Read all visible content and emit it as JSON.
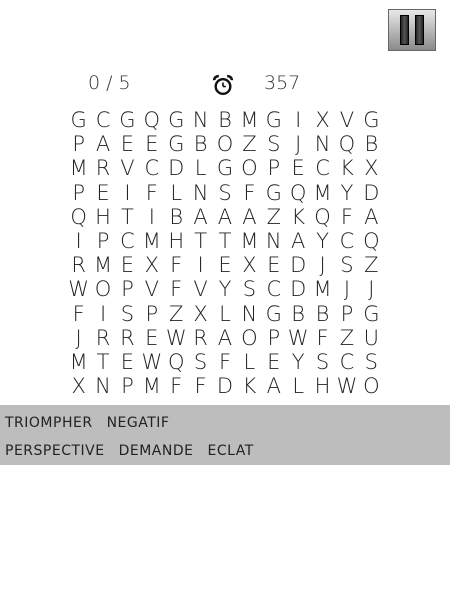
{
  "pause_button": {
    "icon": "pause-icon"
  },
  "stats": {
    "found": "0",
    "separator": "/",
    "total": "5",
    "timer_icon": "alarm-clock-icon",
    "timer": "357"
  },
  "grid": [
    [
      "G",
      "C",
      "G",
      "Q",
      "G",
      "N",
      "B",
      "M",
      "G",
      "I",
      "X",
      "V",
      "G"
    ],
    [
      "P",
      "A",
      "E",
      "E",
      "G",
      "B",
      "O",
      "Z",
      "S",
      "J",
      "N",
      "Q",
      "B"
    ],
    [
      "M",
      "R",
      "V",
      "C",
      "D",
      "L",
      "G",
      "O",
      "P",
      "E",
      "C",
      "K",
      "X"
    ],
    [
      "P",
      "E",
      "I",
      "F",
      "L",
      "N",
      "S",
      "F",
      "G",
      "Q",
      "M",
      "Y",
      "D"
    ],
    [
      "Q",
      "H",
      "T",
      "I",
      "B",
      "A",
      "A",
      "A",
      "Z",
      "K",
      "Q",
      "F",
      "A"
    ],
    [
      "I",
      "P",
      "C",
      "M",
      "H",
      "T",
      "T",
      "M",
      "N",
      "A",
      "Y",
      "C",
      "Q"
    ],
    [
      "R",
      "M",
      "E",
      "X",
      "F",
      "I",
      "E",
      "X",
      "E",
      "D",
      "J",
      "S",
      "Z"
    ],
    [
      "W",
      "O",
      "P",
      "V",
      "F",
      "V",
      "Y",
      "S",
      "C",
      "D",
      "M",
      "J",
      "J"
    ],
    [
      "F",
      "I",
      "S",
      "P",
      "Z",
      "X",
      "L",
      "N",
      "G",
      "B",
      "B",
      "P",
      "G"
    ],
    [
      "J",
      "R",
      "R",
      "E",
      "W",
      "R",
      "A",
      "O",
      "P",
      "W",
      "F",
      "Z",
      "U"
    ],
    [
      "M",
      "T",
      "E",
      "W",
      "Q",
      "S",
      "F",
      "L",
      "E",
      "Y",
      "S",
      "C",
      "S"
    ],
    [
      "X",
      "N",
      "P",
      "M",
      "F",
      "F",
      "D",
      "K",
      "A",
      "L",
      "H",
      "W",
      "O"
    ]
  ],
  "words": [
    [
      "TRIOMPHER",
      "NEGATIF"
    ],
    [
      "PERSPECTIVE",
      "DEMANDE",
      "ECLAT"
    ]
  ]
}
